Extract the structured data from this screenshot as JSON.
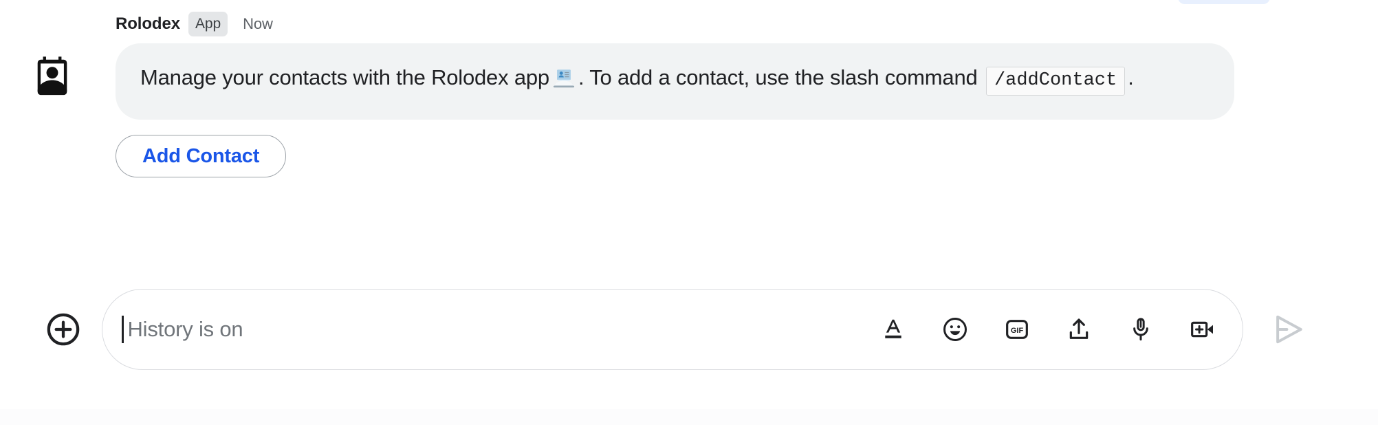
{
  "message": {
    "sender_name": "Rolodex",
    "app_badge": "App",
    "timestamp": "Now",
    "avatar_icon": "contact-card-icon",
    "body_part1": "Manage your contacts with the Rolodex app",
    "body_emoji": "card-index-emoji",
    "body_part2": ". To add a contact, use the slash command",
    "code_chip": "/addContact",
    "body_part3": ".",
    "action_button_label": "Add Contact",
    "action_button_color": "#1a56e8",
    "bubble_color": "#f1f3f4",
    "badge_color": "#e4e6e8"
  },
  "composer": {
    "add_icon": "plus-circle-icon",
    "placeholder": "History is on",
    "input_value": "",
    "tools": [
      {
        "name": "format-text-icon",
        "label": "Format"
      },
      {
        "name": "emoji-icon",
        "label": "Emoji"
      },
      {
        "name": "gif-icon",
        "label": "GIF"
      },
      {
        "name": "upload-icon",
        "label": "Upload file"
      },
      {
        "name": "microphone-icon",
        "label": "Voice message"
      },
      {
        "name": "video-add-icon",
        "label": "Add video meeting"
      }
    ],
    "gif_label": "GIF",
    "send_icon": "send-icon",
    "send_disabled_color": "#c8ccd0"
  }
}
